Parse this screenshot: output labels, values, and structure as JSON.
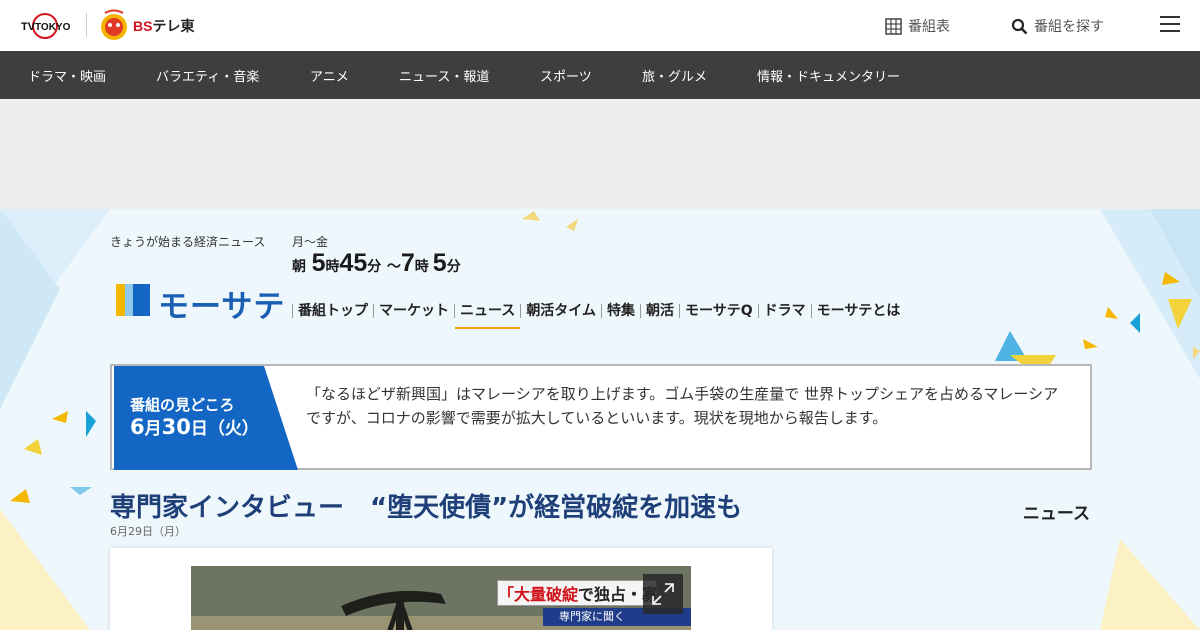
{
  "header": {
    "logo_tvtokyo": "TVTOKYO",
    "logo_bs_prefix": "BS",
    "logo_bs_rest": "テレ東",
    "program_guide_label": "番組表",
    "search_label": "番組を探す"
  },
  "genre_nav": {
    "items": [
      "ドラマ・映画",
      "バラエティ・音楽",
      "アニメ",
      "ニュース・報道",
      "スポーツ",
      "旅・グルメ",
      "情報・ドキュメンタリー"
    ]
  },
  "show": {
    "tagline": "きょうが始まる経済ニュース",
    "days": "月～金",
    "airtime": {
      "prefix": "朝",
      "start_h": "5",
      "h_unit": "時",
      "start_m": "45",
      "m_unit": "分",
      "sep": "～",
      "end_h": "7",
      "end_m": "5"
    },
    "logo_text": "モーサテ",
    "subnav": [
      "番組トップ",
      "マーケット",
      "ニュース",
      "朝活タイム",
      "特集",
      "朝活",
      "モーサテQ",
      "ドラマ",
      "モーサテとは"
    ],
    "subnav_active": "ニュース"
  },
  "highlight": {
    "label": "番組の見どころ",
    "date_month": "6",
    "date_month_unit": "月",
    "date_day": "30",
    "date_day_unit": "日",
    "date_weekday": "（火）",
    "description": "「なるほどザ新興国」はマレーシアを取り上げます。ゴム手袋の生産量で 世界トップシェアを占めるマレーシアですが、コロナの影響で需要が拡大しているといいます。現状を現地から報告します。"
  },
  "article": {
    "title": "専門家インタビュー　“堕天使債”が経営破綻を加速も",
    "date": "6月29日（月）",
    "category": "ニュース",
    "caption_red": "「大量破綻",
    "caption_black": "で独占・寡占進む",
    "caption_sub": "専門家に聞く"
  },
  "colors": {
    "nav_bg": "#3e3e3e",
    "brand_blue": "#1466c4",
    "title_navy": "#1e3f78",
    "accent_orange": "#f0a30a"
  }
}
